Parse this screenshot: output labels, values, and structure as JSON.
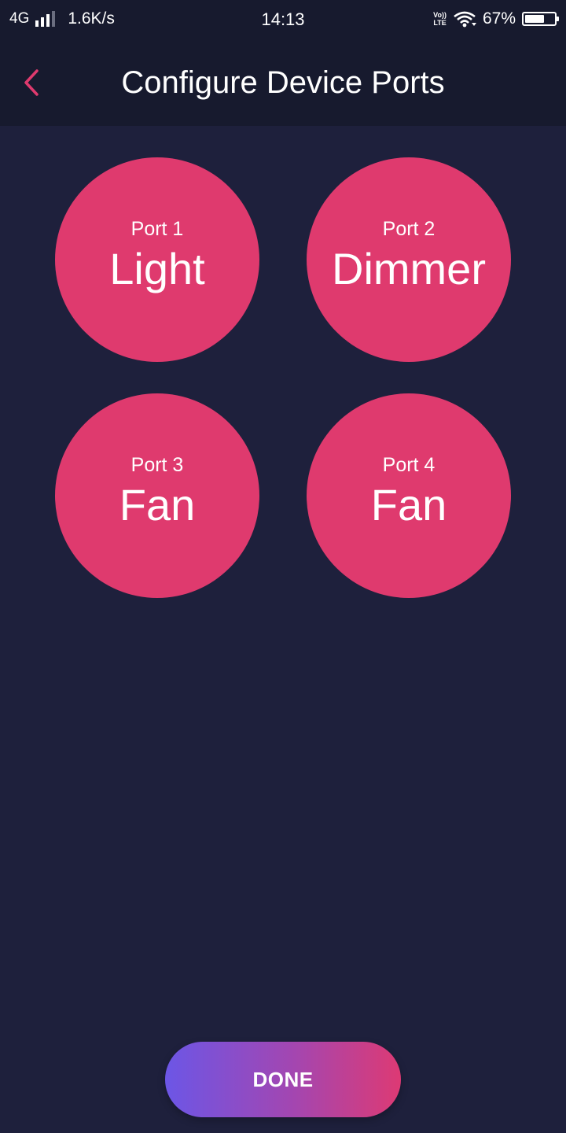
{
  "status_bar": {
    "network_type": "4G",
    "speed": "1.6K/s",
    "time": "14:13",
    "volte_line1": "Vo))",
    "volte_line2": "LTE",
    "battery_percent": "67%",
    "battery_level": 0.67
  },
  "header": {
    "title": "Configure Device Ports",
    "back_icon": "chevron-left-icon"
  },
  "ports": [
    {
      "label": "Port 1",
      "type": "Light"
    },
    {
      "label": "Port 2",
      "type": "Dimmer"
    },
    {
      "label": "Port 3",
      "type": "Fan"
    },
    {
      "label": "Port 4",
      "type": "Fan"
    }
  ],
  "done_button": {
    "label": "DONE"
  },
  "colors": {
    "background": "#1e203c",
    "header_background": "#171a2e",
    "port_circle": "#df3a6e",
    "back_icon": "#df3a6e",
    "done_gradient_start": "#6c56e6",
    "done_gradient_end": "#dd3a74"
  }
}
